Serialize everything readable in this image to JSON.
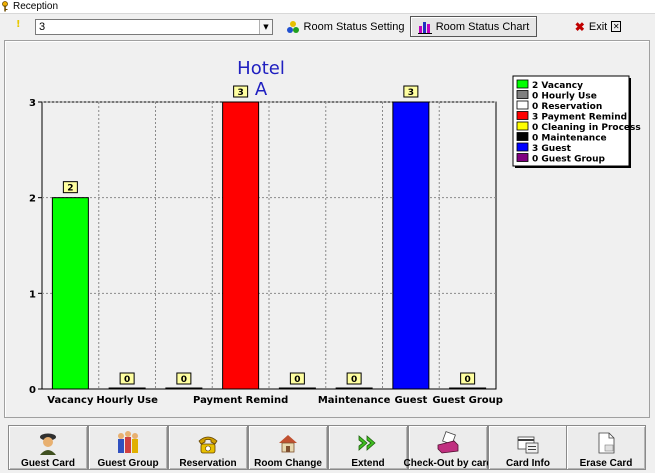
{
  "window": {
    "title": "Reception"
  },
  "toolbar": {
    "marker": "!",
    "floor_select": {
      "value": "3"
    },
    "room_status_setting": "Room Status Setting",
    "room_status_chart": "Room Status Chart",
    "exit": "Exit"
  },
  "chart_data": {
    "type": "bar",
    "title": "Hotel\nA",
    "title_lines": [
      "Hotel",
      "A"
    ],
    "categories": [
      "Vacancy",
      "Hourly Use",
      "Reservation",
      "Payment Remind",
      "Cleaning in Process",
      "Maintenance",
      "Guest",
      "Guest Group"
    ],
    "tick_labels": [
      "Vacancy",
      "Hourly Use",
      "",
      "Payment Remind",
      "",
      "Maintenance",
      "Guest",
      "Guest Group"
    ],
    "values": [
      2,
      0,
      0,
      3,
      0,
      0,
      3,
      0
    ],
    "colors": [
      "#00ff00",
      "#808080",
      "#ffffff",
      "#ff0000",
      "#ffff00",
      "#000000",
      "#0000ff",
      "#800080"
    ],
    "ylim": [
      0,
      3
    ],
    "yticks": [
      0,
      1,
      2,
      3
    ],
    "grid": true,
    "legend_position": "top-right",
    "legend": [
      "2 Vacancy",
      "0 Hourly Use",
      "0 Reservation",
      "3 Payment Remind",
      "0 Cleaning in Process",
      "0 Maintenance",
      "3 Guest",
      "0 Guest Group"
    ]
  },
  "bottom_buttons": [
    {
      "label": "Guest Card",
      "icon": "person-icon"
    },
    {
      "label": "Guest Group",
      "icon": "group-icon"
    },
    {
      "label": "Reservation",
      "icon": "phone-icon"
    },
    {
      "label": "Room Change",
      "icon": "house-icon"
    },
    {
      "label": "Extend",
      "icon": "forward-arrow-icon"
    },
    {
      "label": "Check-Out by card",
      "icon": "card-reader-icon"
    },
    {
      "label": "Card Info",
      "icon": "card-info-icon"
    },
    {
      "label": "Erase Card",
      "icon": "erase-card-icon"
    }
  ]
}
